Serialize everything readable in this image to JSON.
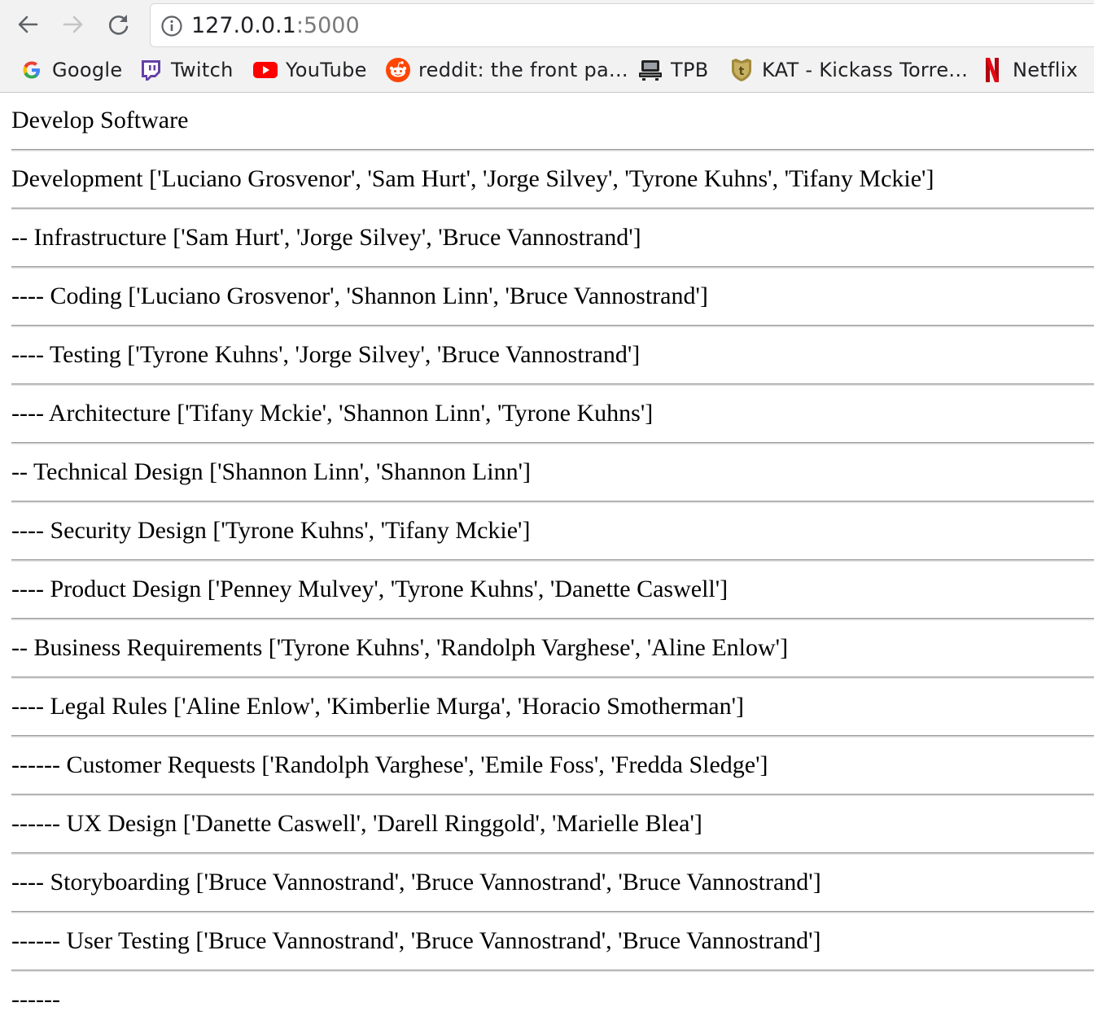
{
  "browser": {
    "url_host": "127.0.0.1",
    "url_port": ":5000",
    "bookmarks": [
      {
        "label": "Google",
        "icon": "google-icon"
      },
      {
        "label": "Twitch",
        "icon": "twitch-icon"
      },
      {
        "label": "YouTube",
        "icon": "youtube-icon"
      },
      {
        "label": "reddit: the front pa...",
        "icon": "reddit-icon"
      },
      {
        "label": "TPB",
        "icon": "tpb-icon"
      },
      {
        "label": "KAT - Kickass Torre...",
        "icon": "kat-icon"
      },
      {
        "label": "Netflix",
        "icon": "netflix-icon"
      }
    ]
  },
  "page": {
    "rows": [
      "Develop Software",
      "Development ['Luciano Grosvenor', 'Sam Hurt', 'Jorge Silvey', 'Tyrone Kuhns', 'Tifany Mckie']",
      "-- Infrastructure ['Sam Hurt', 'Jorge Silvey', 'Bruce Vannostrand']",
      "---- Coding ['Luciano Grosvenor', 'Shannon Linn', 'Bruce Vannostrand']",
      "---- Testing ['Tyrone Kuhns', 'Jorge Silvey', 'Bruce Vannostrand']",
      "---- Architecture ['Tifany Mckie', 'Shannon Linn', 'Tyrone Kuhns']",
      "-- Technical Design ['Shannon Linn', 'Shannon Linn']",
      "---- Security Design ['Tyrone Kuhns', 'Tifany Mckie']",
      "---- Product Design ['Penney Mulvey', 'Tyrone Kuhns', 'Danette Caswell']",
      "-- Business Requirements ['Tyrone Kuhns', 'Randolph Varghese', 'Aline Enlow']",
      "---- Legal Rules ['Aline Enlow', 'Kimberlie Murga', 'Horacio Smotherman']",
      "------ Customer Requests ['Randolph Varghese', 'Emile Foss', 'Fredda Sledge']",
      "------ UX Design ['Danette Caswell', 'Darell Ringgold', 'Marielle Blea']",
      "---- Storyboarding ['Bruce Vannostrand', 'Bruce Vannostrand', 'Bruce Vannostrand']",
      "------ User Testing ['Bruce Vannostrand', 'Bruce Vannostrand', 'Bruce Vannostrand']",
      "------"
    ]
  },
  "colors": {
    "chrome_bg": "#f2f2f2",
    "youtube_red": "#ff0000",
    "twitch_purple": "#6441a5",
    "reddit_orange": "#ff4500",
    "netflix_red": "#e50914",
    "kat_gold": "#a08a3c"
  }
}
